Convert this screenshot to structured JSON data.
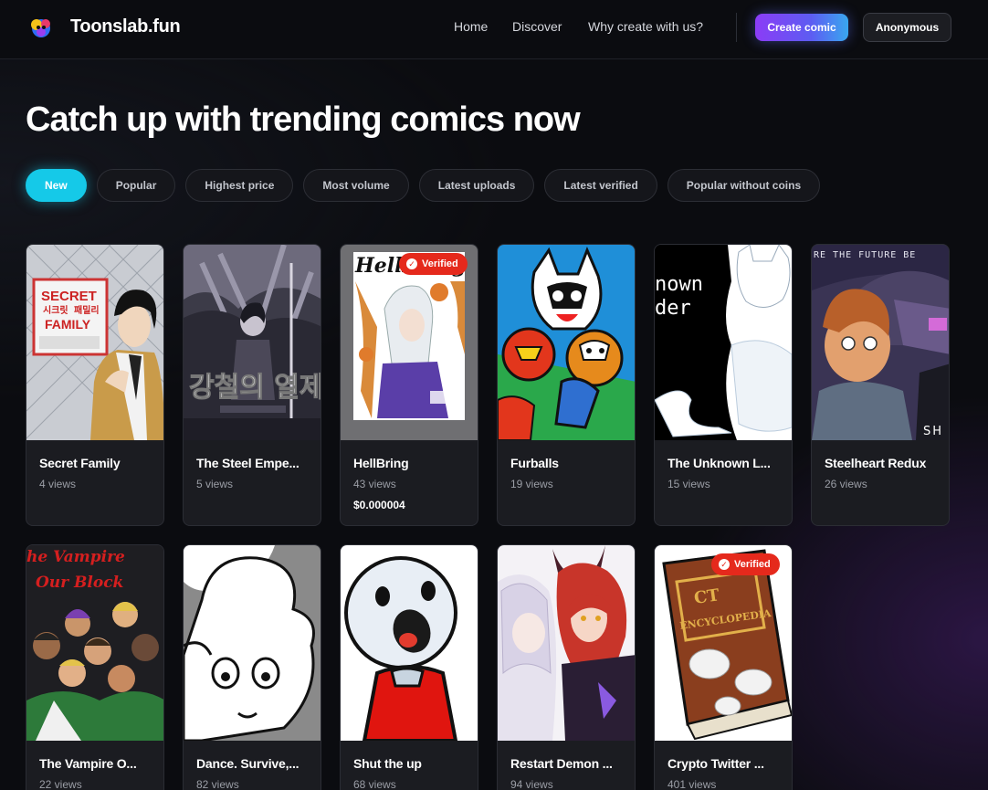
{
  "header": {
    "brand": "Toonslab.fun",
    "nav": [
      {
        "label": "Home"
      },
      {
        "label": "Discover"
      },
      {
        "label": "Why create with us?"
      }
    ],
    "create_label": "Create comic",
    "user_label": "Anonymous",
    "accent_gradient": [
      "#8b3cf6",
      "#39a7f0"
    ]
  },
  "page_title": "Catch up with trending comics now",
  "filters": {
    "active": "New",
    "items": [
      "New",
      "Popular",
      "Highest price",
      "Most volume",
      "Latest uploads",
      "Latest verified",
      "Popular without coins"
    ],
    "active_color": "#15c9e8"
  },
  "comics": [
    {
      "title": "Secret Family",
      "views": "4 views",
      "price": "",
      "verified": false
    },
    {
      "title": "The Steel Empe...",
      "views": "5 views",
      "price": "",
      "verified": false
    },
    {
      "title": "HellBring",
      "views": "43 views",
      "price": "$0.000004",
      "verified": true
    },
    {
      "title": "Furballs",
      "views": "19 views",
      "price": "",
      "verified": false
    },
    {
      "title": "The Unknown L...",
      "views": "15 views",
      "price": "",
      "verified": false
    },
    {
      "title": "Steelheart Redux",
      "views": "26 views",
      "price": "",
      "verified": false
    },
    {
      "title": "The Vampire O...",
      "views": "22 views",
      "price": "",
      "verified": false
    },
    {
      "title": "Dance. Survive,...",
      "views": "82 views",
      "price": "",
      "verified": false
    },
    {
      "title": "Shut the up",
      "views": "68 views",
      "price": "",
      "verified": false
    },
    {
      "title": "Restart Demon ...",
      "views": "94 views",
      "price": "",
      "verified": false
    },
    {
      "title": "Crypto Twitter ...",
      "views": "401 views",
      "price": "",
      "verified": true
    }
  ],
  "badge_label": "Verified",
  "badge_color": "#e5291c",
  "cover_art": {
    "secret_family": {
      "title_line1": "SECRET",
      "title_line2": "시크릿",
      "title_line3": "패밀리",
      "title_line4": "FAMILY"
    },
    "steel_emperor": {
      "title": "강철의 열제"
    },
    "hellbring": {
      "title": "HellBring"
    },
    "unknown": {
      "line1": "nown",
      "line2": "der"
    },
    "steelheart": {
      "banner": "RE THE FUTURE BE",
      "corner": "SH"
    },
    "vampire": {
      "line1": "he Vampire",
      "line2": "Our Block"
    },
    "crypto": {
      "line1": "CT",
      "line2": "ENCYCLOPEDIA"
    }
  }
}
